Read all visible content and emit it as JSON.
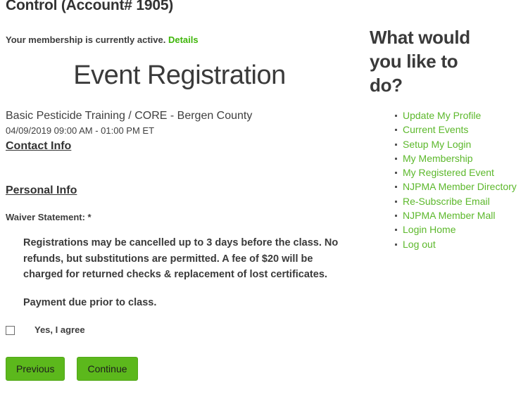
{
  "header": {
    "account_title": "Control (Account# 1905)",
    "membership_status": "Your membership is currently active.",
    "details_link": "Details"
  },
  "main": {
    "page_title": "Event Registration",
    "event_name": "Basic Pesticide Training / CORE - Bergen County",
    "event_date": "04/09/2019 09:00 AM - 01:00 PM ET",
    "contact_info_heading": "Contact Info",
    "personal_info_heading": "Personal Info",
    "waiver_label": "Waiver Statement: *",
    "waiver_paragraph_1": "Registrations may be cancelled up to 3 days before the class. No refunds, but substitutions are permitted. A fee of $20 will be charged for returned checks & replacement of lost certificates.",
    "waiver_paragraph_2": "Payment due prior to class.",
    "agree_label": "Yes, I agree",
    "agree_checked": false,
    "previous_button": "Previous",
    "continue_button": "Continue"
  },
  "sidebar": {
    "title": "What would you like to do?",
    "items": [
      {
        "label": "Update My Profile"
      },
      {
        "label": "Current Events"
      },
      {
        "label": "Setup My Login"
      },
      {
        "label": "My Membership"
      },
      {
        "label": "My Registered Event"
      },
      {
        "label": "NJPMA Member Directory"
      },
      {
        "label": "Re-Subscribe Email"
      },
      {
        "label": "NJPMA Member Mall"
      },
      {
        "label": "Login Home"
      },
      {
        "label": "Log out"
      }
    ]
  },
  "colors": {
    "link_green": "#5cb82b",
    "details_green": "#3fb60a",
    "button_green": "#5cb81c",
    "text_dark": "#3a3a3a"
  }
}
